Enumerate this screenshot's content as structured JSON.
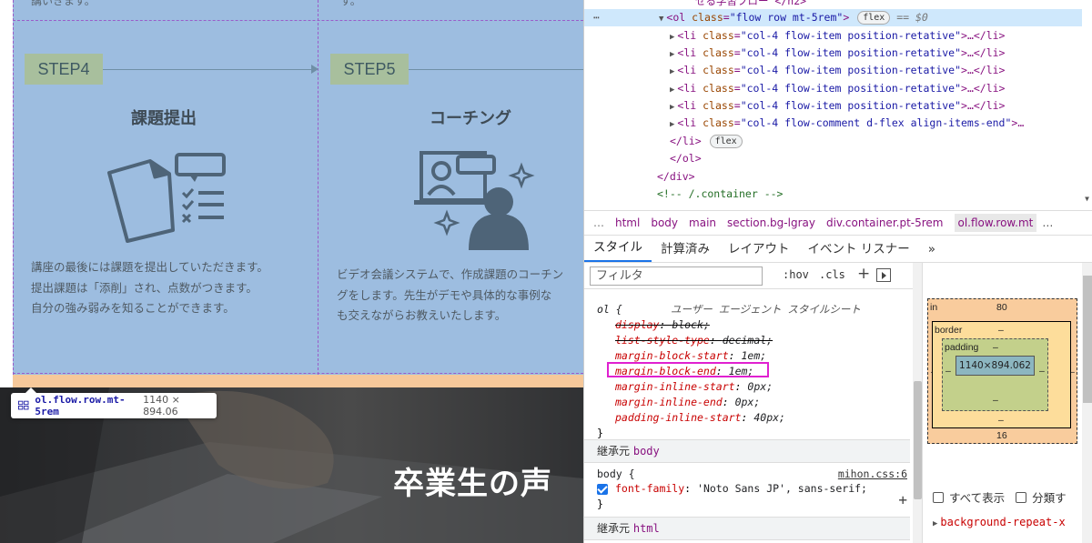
{
  "page": {
    "top_cut_left": "講いきます。",
    "top_cut_right": "す。",
    "steps": [
      {
        "badge": "STEP4",
        "title": "課題提出",
        "text": "講座の最後には課題を提出していただきます。\n提出課題は「添削」され、点数がつきます。\n自分の強み弱みを知ることができます。"
      },
      {
        "badge": "STEP5",
        "title": "コーチング",
        "text": "ビデオ会議システムで、作成課題のコーチン\nグをします。先生がデモや具体的な事例な\nも交えながらお教えいたします。"
      }
    ],
    "tooltip": {
      "selector": "ol.flow.row.mt-5rem",
      "size": "1140 × 894.06"
    },
    "hero_title": "卒業生の声"
  },
  "devtools": {
    "elements": {
      "cut_line": "せる学習フロー </h2>",
      "selected_line": {
        "tag_open": "<ol ",
        "attr_name": "class",
        "attr_value": "\"flow row mt-5rem\"",
        "tag_close": ">",
        "pill": "flex",
        "dollar": "== $0"
      },
      "li_items": [
        {
          "cls": "\"col-4 flow-item position-retative\"",
          "rest": ">…</li>"
        },
        {
          "cls": "\"col-4 flow-item position-retative\"",
          "rest": ">…</li>"
        },
        {
          "cls": "\"col-4 flow-item position-retative\"",
          "rest": ">…</li>"
        },
        {
          "cls": "\"col-4 flow-item position-retative\"",
          "rest": ">…</li>"
        },
        {
          "cls": "\"col-4 flow-item position-retative\"",
          "rest": ">…</li>"
        },
        {
          "cls": "\"col-4 flow-comment d-flex align-items-end\"",
          "rest": ">…"
        }
      ],
      "close_li": "</li>",
      "close_li_pill": "flex",
      "close_ol": "</ol>",
      "close_div": "</div>",
      "comment": "<!-- /.container -->"
    },
    "breadcrumb": [
      "html",
      "body",
      "main",
      "section.bg-lgray",
      "div.container.pt-5rem",
      "ol.flow.row.mt"
    ],
    "tabs": [
      "スタイル",
      "計算済み",
      "レイアウト",
      "イベント リスナー",
      "»"
    ],
    "filter_placeholder": "フィルタ",
    "hov": ":hov",
    "cls": ".cls",
    "ua_rule": {
      "selector": "ol {",
      "source": "ユーザー エージェント スタイルシート",
      "props": [
        {
          "name": "display",
          "value": "block;"
        },
        {
          "name": "list-style-type",
          "value": "decimal;"
        },
        {
          "name": "margin-block-start",
          "value": "1em;"
        },
        {
          "name": "margin-block-end",
          "value": "1em;"
        },
        {
          "name": "margin-inline-start",
          "value": "0px;"
        },
        {
          "name": "margin-inline-end",
          "value": "0px;"
        },
        {
          "name": "padding-inline-start",
          "value": "40px;"
        }
      ],
      "close": "}"
    },
    "inherited_body": {
      "label": "継承元",
      "tag": "body"
    },
    "body_rule": {
      "selector": "body {",
      "link": "mihon.css:6",
      "prop": "font-family",
      "value": "'Noto Sans JP', sans-serif;",
      "close": "}"
    },
    "inherited_html": {
      "label": "継承元",
      "tag": "html"
    },
    "box_model": {
      "margin_label": "in",
      "margin_top": "80",
      "margin_bottom": "16",
      "margin_side": "–",
      "border_label": "border",
      "border_value": "–",
      "padding_label": "padding",
      "padding_value": "–",
      "content": "1140×894.062"
    },
    "show_all": "すべて表示",
    "group": "分類す",
    "bg_repeat": "background-repeat-x"
  },
  "colors": {
    "accent": "#1a73e8",
    "overlay": "#9dbde0",
    "step_badge": "#a8bf9d",
    "highlight": "#e020d0"
  }
}
